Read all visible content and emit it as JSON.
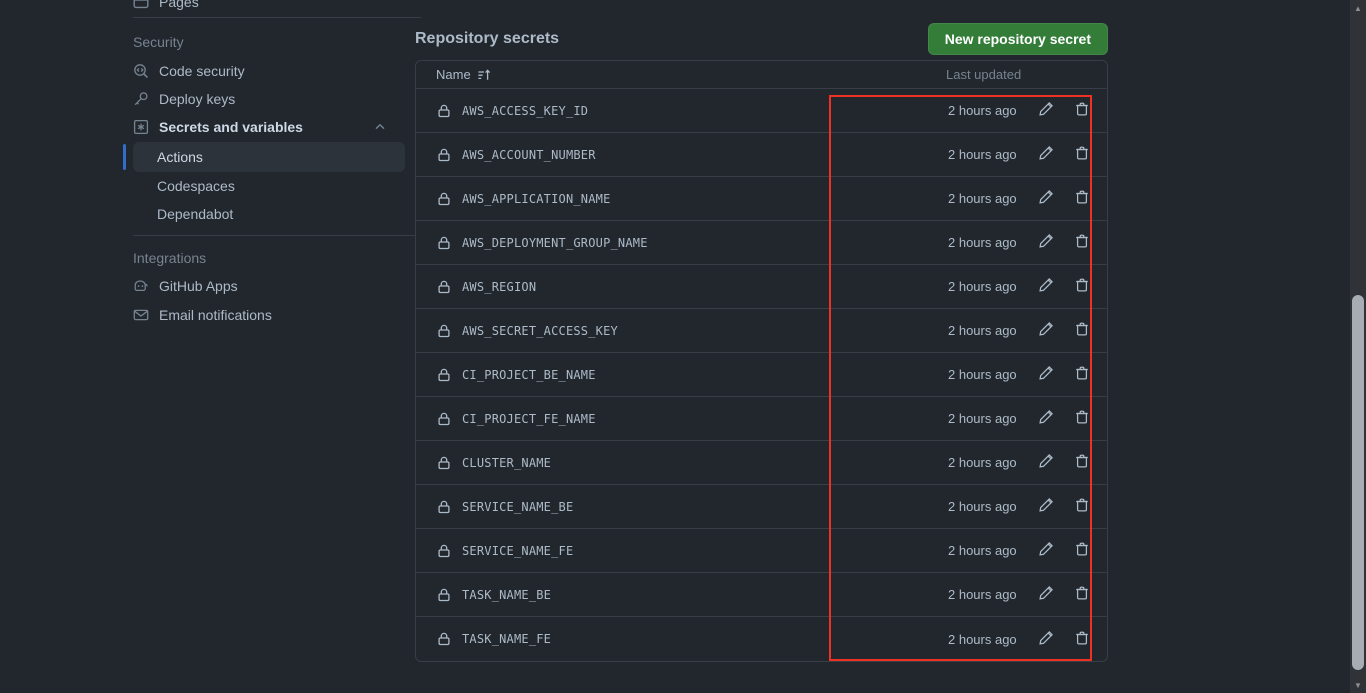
{
  "sidebar": {
    "pages_item": {
      "label": "Pages",
      "icon": "browser-icon"
    },
    "security": {
      "heading": "Security",
      "items": [
        {
          "label": "Code security",
          "icon": "codescan-icon"
        },
        {
          "label": "Deploy keys",
          "icon": "key-icon"
        },
        {
          "label": "Secrets and variables",
          "icon": "asterisk-square-icon",
          "expanded": true,
          "chevron": "chevron-up-icon"
        }
      ],
      "sub_items": [
        {
          "label": "Actions",
          "active": true
        },
        {
          "label": "Codespaces",
          "active": false
        },
        {
          "label": "Dependabot",
          "active": false
        }
      ]
    },
    "integrations": {
      "heading": "Integrations",
      "items": [
        {
          "label": "GitHub Apps",
          "icon": "apps-robot-icon"
        },
        {
          "label": "Email notifications",
          "icon": "mail-icon"
        }
      ]
    }
  },
  "main": {
    "title": "Repository secrets",
    "new_secret_button": "New repository secret",
    "table": {
      "columns": {
        "name": "Name",
        "sort_icon": "sort-asc-icon",
        "last_updated": "Last updated"
      },
      "row_actions": {
        "edit_icon": "pencil-icon",
        "delete_icon": "trash-icon"
      },
      "rows": [
        {
          "name": "AWS_ACCESS_KEY_ID",
          "icon": "lock-icon",
          "last_updated": "2 hours ago"
        },
        {
          "name": "AWS_ACCOUNT_NUMBER",
          "icon": "lock-icon",
          "last_updated": "2 hours ago"
        },
        {
          "name": "AWS_APPLICATION_NAME",
          "icon": "lock-icon",
          "last_updated": "2 hours ago"
        },
        {
          "name": "AWS_DEPLOYMENT_GROUP_NAME",
          "icon": "lock-icon",
          "last_updated": "2 hours ago"
        },
        {
          "name": "AWS_REGION",
          "icon": "lock-icon",
          "last_updated": "2 hours ago"
        },
        {
          "name": "AWS_SECRET_ACCESS_KEY",
          "icon": "lock-icon",
          "last_updated": "2 hours ago"
        },
        {
          "name": "CI_PROJECT_BE_NAME",
          "icon": "lock-icon",
          "last_updated": "2 hours ago"
        },
        {
          "name": "CI_PROJECT_FE_NAME",
          "icon": "lock-icon",
          "last_updated": "2 hours ago"
        },
        {
          "name": "CLUSTER_NAME",
          "icon": "lock-icon",
          "last_updated": "2 hours ago"
        },
        {
          "name": "SERVICE_NAME_BE",
          "icon": "lock-icon",
          "last_updated": "2 hours ago"
        },
        {
          "name": "SERVICE_NAME_FE",
          "icon": "lock-icon",
          "last_updated": "2 hours ago"
        },
        {
          "name": "TASK_NAME_BE",
          "icon": "lock-icon",
          "last_updated": "2 hours ago"
        },
        {
          "name": "TASK_NAME_FE",
          "icon": "lock-icon",
          "last_updated": "2 hours ago"
        }
      ]
    }
  },
  "annotation": {
    "color": "#ef3124",
    "shape": "rectangle-highlight"
  },
  "colors": {
    "background": "#22272e",
    "border": "#373e47",
    "text_primary": "#adbac7",
    "text_muted": "#768390",
    "accent_green": "#347d39",
    "accent_blue": "#316dca",
    "annotation_red": "#ef3124"
  }
}
